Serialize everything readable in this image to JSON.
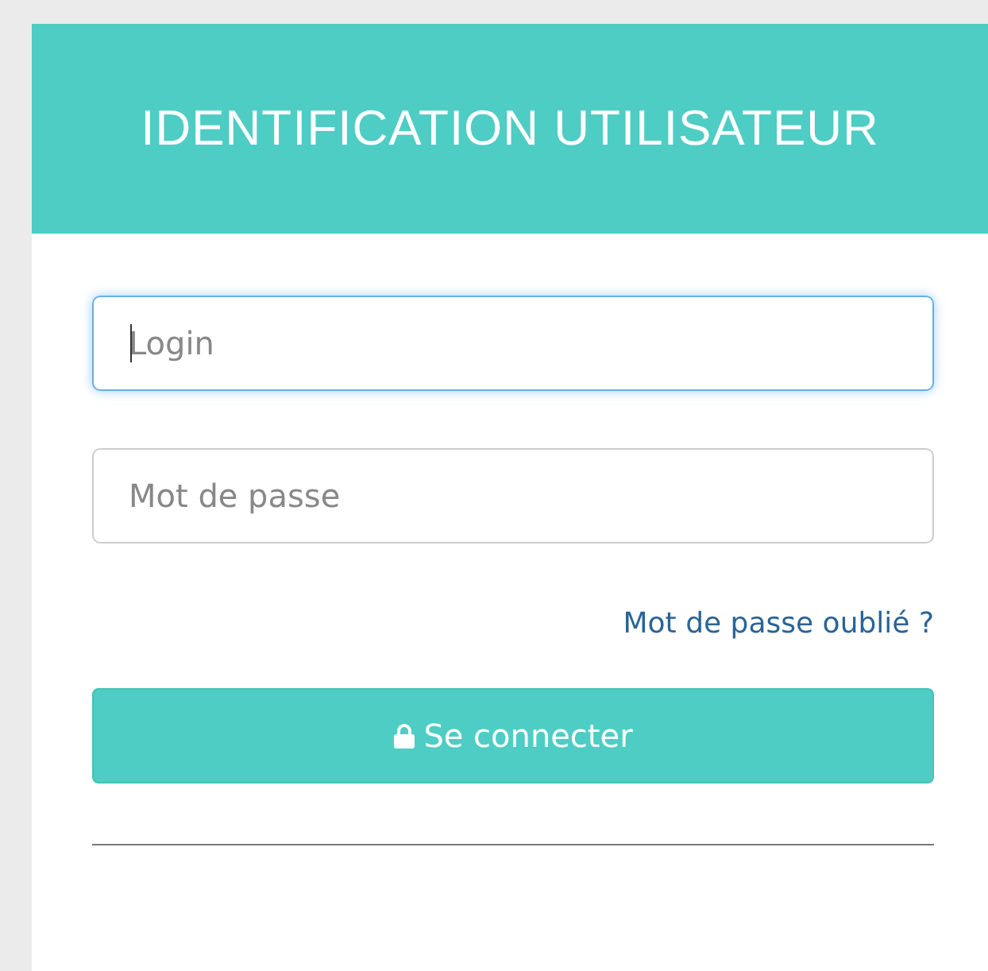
{
  "header": {
    "title": "IDENTIFICATION UTILISATEUR"
  },
  "fields": [
    {
      "placeholder": "Login",
      "focused": true
    },
    {
      "placeholder": "Mot de passe",
      "focused": false
    }
  ],
  "forgot_link": "Mot de passe oublié ?",
  "submit_button": {
    "label": "Se connecter"
  }
}
